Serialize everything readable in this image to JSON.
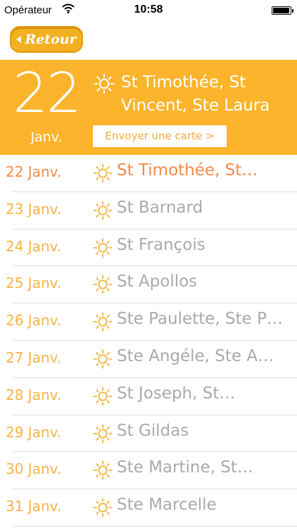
{
  "status_bar": {
    "carrier": "Opérateur",
    "time": "10:58",
    "battery_level": 0.95
  },
  "nav": {
    "back_label": "Retour"
  },
  "hero": {
    "day": "22",
    "month": "Janv.",
    "names": "St Timothée, St Vincent, Ste Laura",
    "send_card_label": "Envoyer une carte >"
  },
  "colors": {
    "accent": "#fbb42b",
    "date_text": "#f6b447",
    "selected_text": "#f38a4a",
    "name_text": "#aaaaaa"
  },
  "list": [
    {
      "date": "22 Janv.",
      "names": "St Timothée, St…",
      "selected": true
    },
    {
      "date": "23 Janv.",
      "names": "St Barnard"
    },
    {
      "date": "24 Janv.",
      "names": "St François"
    },
    {
      "date": "25 Janv.",
      "names": "St Apollos"
    },
    {
      "date": "26 Janv.",
      "names": "Ste Paulette, Ste P…"
    },
    {
      "date": "27 Janv.",
      "names": "Ste Angéle, Ste A…"
    },
    {
      "date": "28 Janv.",
      "names": "St Joseph, St…"
    },
    {
      "date": "29 Janv.",
      "names": "St Gildas"
    },
    {
      "date": "30 Janv.",
      "names": "Ste Martine, St…"
    },
    {
      "date": "31 Janv.",
      "names": "Ste Marcelle"
    }
  ]
}
